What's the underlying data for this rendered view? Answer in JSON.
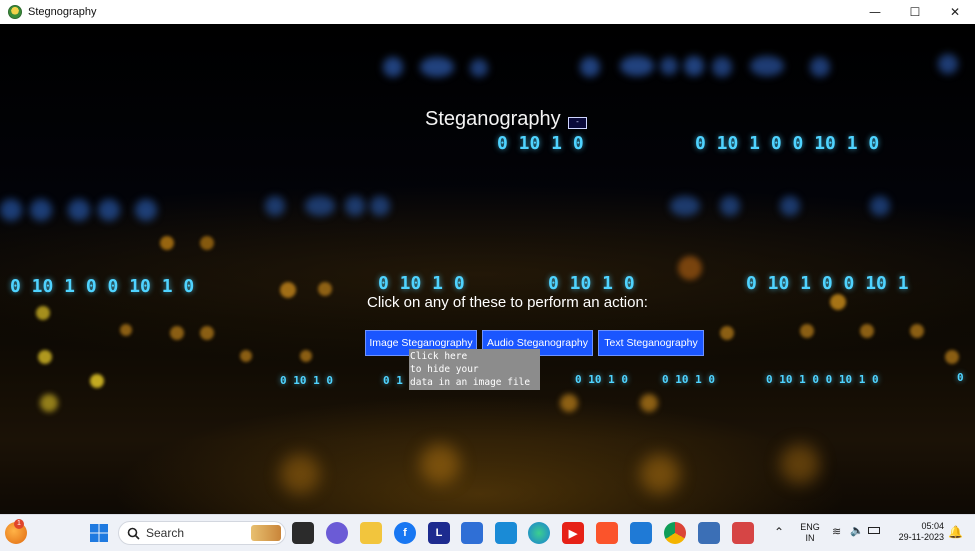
{
  "window": {
    "title": "Stegnography",
    "minimize": "—",
    "maximize": "☐",
    "close": "✕"
  },
  "main": {
    "heading": "Steganography",
    "mini_button": "-",
    "prompt": "Click on any of these to perform an action:",
    "buttons": {
      "image": "Image Steganography",
      "audio": "Audio Steganography",
      "text": "Text Steganography"
    },
    "tooltip": [
      "Click here",
      "to hide your",
      "data in an image file"
    ]
  },
  "background_binary": {
    "row1_left": "0 10 1 0",
    "row1_right": "0 10 1 0 0 10 1 0",
    "row2_a": "0 10 1 0 0 10 1 0",
    "row2_b": "0 10 1 0",
    "row2_c": "0 10 1 0",
    "row2_d": "0 10 1 0 0 10 1",
    "row3_a": "0 10 1 0",
    "row3_b": "0 1",
    "row3_c": "0 10 1 0",
    "row3_d": "0 10 1 0",
    "row3_e": "0 10 1 0 0 10 1 0",
    "row3_f": "0"
  },
  "taskbar": {
    "notification_count": "1",
    "search_placeholder": "Search",
    "language_top": "ENG",
    "language_bottom": "IN",
    "time": "05:04",
    "date": "29-11-2023"
  }
}
